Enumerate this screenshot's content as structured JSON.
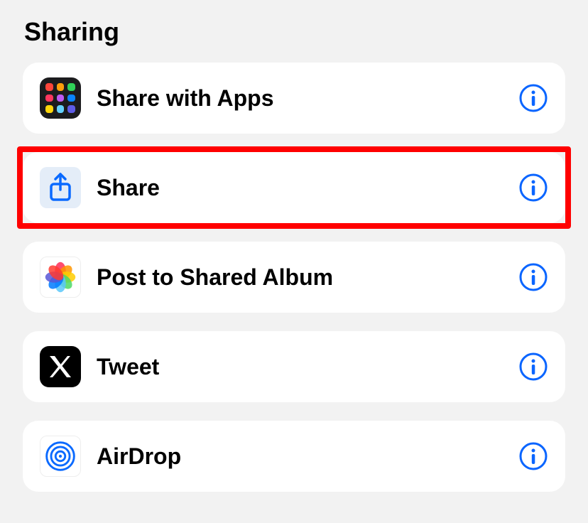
{
  "section": {
    "title": "Sharing"
  },
  "items": [
    {
      "label": "Share with Apps",
      "icon": "app-grid-icon",
      "highlighted": false
    },
    {
      "label": "Share",
      "icon": "share-icon",
      "highlighted": true
    },
    {
      "label": "Post to Shared Album",
      "icon": "photos-icon",
      "highlighted": false
    },
    {
      "label": "Tweet",
      "icon": "x-icon",
      "highlighted": false
    },
    {
      "label": "AirDrop",
      "icon": "airdrop-icon",
      "highlighted": false
    }
  ],
  "colors": {
    "accent": "#0a65ff",
    "highlight": "#ff0000"
  }
}
